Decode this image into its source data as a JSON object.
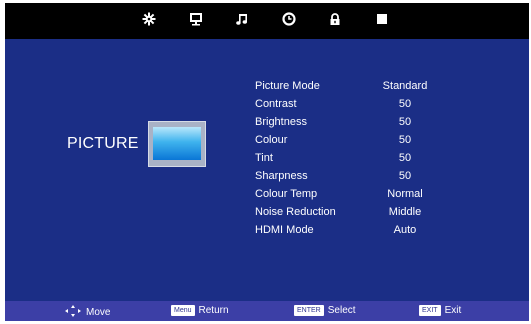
{
  "tabs": [
    {
      "icon": "gear-icon",
      "active": true
    },
    {
      "icon": "monitor-icon",
      "active": false
    },
    {
      "icon": "music-note-icon",
      "active": false
    },
    {
      "icon": "clock-icon",
      "active": false
    },
    {
      "icon": "lock-icon",
      "active": false
    },
    {
      "icon": "square-icon",
      "active": false
    }
  ],
  "section": {
    "title": "PICTURE"
  },
  "settings": [
    {
      "label": "Picture Mode",
      "value": "Standard"
    },
    {
      "label": "Contrast",
      "value": "50"
    },
    {
      "label": "Brightness",
      "value": "50"
    },
    {
      "label": "Colour",
      "value": "50"
    },
    {
      "label": "Tint",
      "value": "50"
    },
    {
      "label": "Sharpness",
      "value": "50"
    },
    {
      "label": "Colour Temp",
      "value": "Normal"
    },
    {
      "label": "Noise Reduction",
      "value": "Middle"
    },
    {
      "label": "HDMI Mode",
      "value": "Auto"
    }
  ],
  "bottom_hints": {
    "move": {
      "label": "Move"
    },
    "return": {
      "key": "Menu",
      "label": "Return"
    },
    "select": {
      "key": "ENTER",
      "label": "Select"
    },
    "exit": {
      "key": "EXIT",
      "label": "Exit"
    }
  },
  "colors": {
    "background": "#1b2e86",
    "topbar": "#000000",
    "bottombar": "#3c3fa6",
    "text": "#ffffff"
  }
}
